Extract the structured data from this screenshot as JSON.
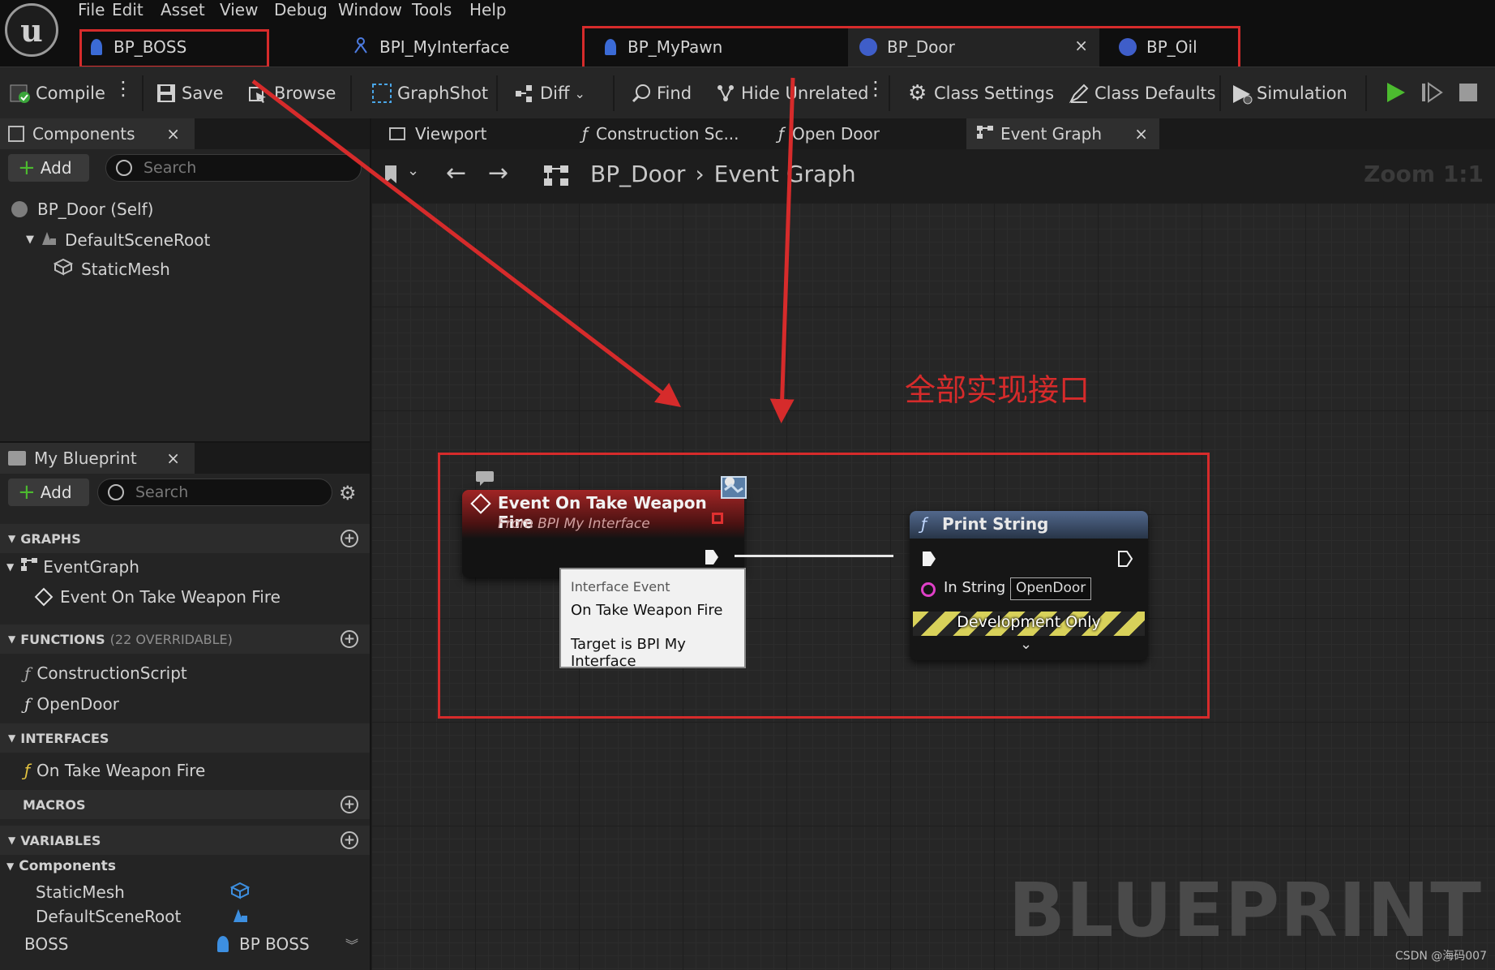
{
  "menu": [
    "File",
    "Edit",
    "Asset",
    "View",
    "Debug",
    "Window",
    "Tools",
    "Help"
  ],
  "doc_tabs": [
    {
      "label": "BP_BOSS",
      "icon": "pawn-icon"
    },
    {
      "label": "BPI_MyInterface",
      "icon": "interface-icon"
    },
    {
      "label": "BP_MyPawn",
      "icon": "pawn-icon"
    },
    {
      "label": "BP_Door",
      "icon": "actor-icon"
    },
    {
      "label": "BP_Oil",
      "icon": "actor-icon"
    }
  ],
  "toolbar": {
    "compile": "Compile",
    "save": "Save",
    "browse": "Browse",
    "graphshot": "GraphShot",
    "diff": "Diff",
    "find": "Find",
    "hide_unrelated": "Hide Unrelated",
    "class_settings": "Class Settings",
    "class_defaults": "Class Defaults",
    "simulation": "Simulation"
  },
  "components_panel": {
    "title": "Components",
    "add": "Add",
    "search_placeholder": "Search",
    "tree": [
      "BP_Door (Self)",
      "DefaultSceneRoot",
      "StaticMesh"
    ]
  },
  "myblueprint": {
    "title": "My Blueprint",
    "add": "Add",
    "search_placeholder": "Search",
    "graphs_header": "GRAPHS",
    "graphs": [
      "EventGraph",
      "Event On Take Weapon Fire"
    ],
    "functions_header": "FUNCTIONS",
    "functions_note": "(22 OVERRIDABLE)",
    "functions": [
      "ConstructionScript",
      "OpenDoor"
    ],
    "interfaces_header": "INTERFACES",
    "interfaces": [
      "On Take Weapon Fire"
    ],
    "macros_header": "MACROS",
    "variables_header": "VARIABLES",
    "components_header": "Components",
    "variables": [
      {
        "name": "StaticMesh",
        "type": ""
      },
      {
        "name": "DefaultSceneRoot",
        "type": ""
      },
      {
        "name": "BOSS",
        "type": "BP BOSS"
      }
    ]
  },
  "graph_tabs": [
    "Viewport",
    "Construction Sc...",
    "Open Door",
    "Event Graph"
  ],
  "breadcrumb": {
    "root": "BP_Door",
    "current": "Event Graph",
    "zoom": "Zoom 1:1"
  },
  "annotation": "全部实现接口",
  "event_node": {
    "title": "Event On Take Weapon Fire",
    "subtitle": "From BPI My Interface"
  },
  "tooltip": {
    "line1": "Interface Event",
    "line2": "On Take Weapon Fire",
    "line3": "Target is BPI My Interface"
  },
  "print_node": {
    "title": "Print String",
    "pin": "In String",
    "value": "OpenDoor",
    "dev": "Development Only"
  },
  "watermark": "BLUEPRINT",
  "credit": "CSDN @海码007",
  "colors": {
    "annotation_red": "#d62b2b",
    "event_header": "#8f1f1f",
    "print_header": "#3e5678"
  }
}
